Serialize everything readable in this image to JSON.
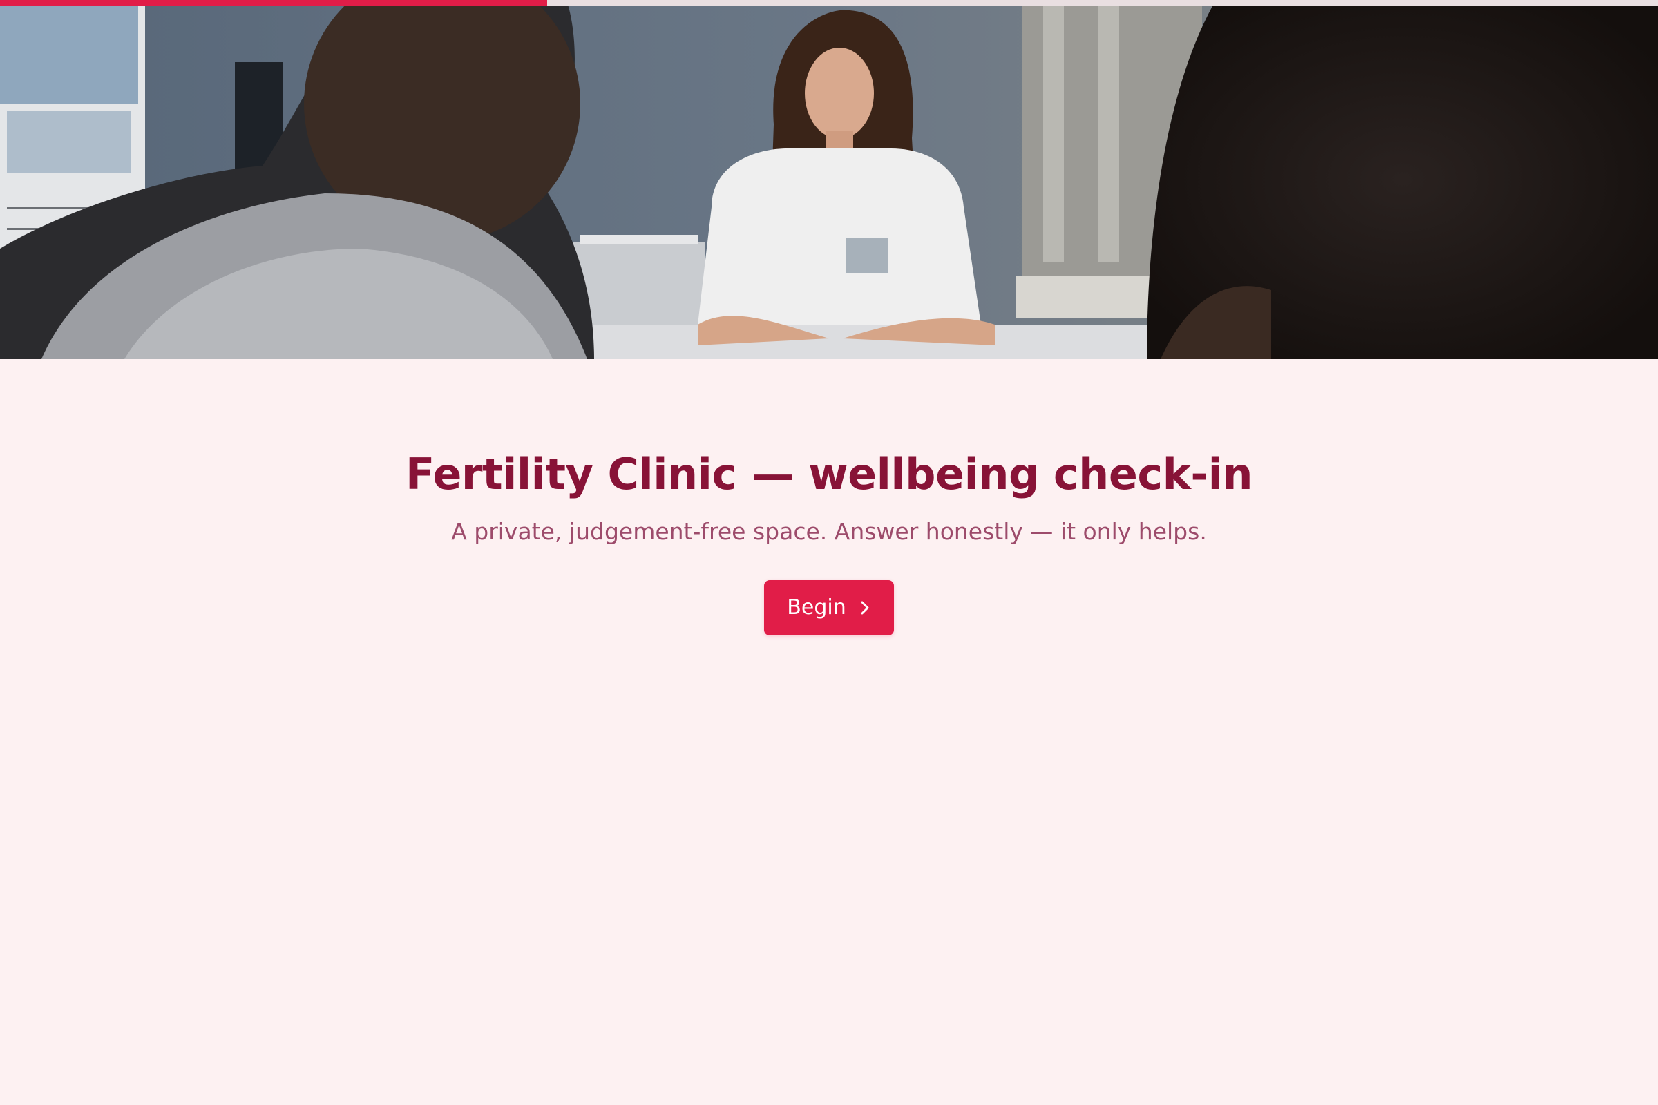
{
  "progress": {
    "fraction": 0.33
  },
  "hero": {
    "image": "clinic-consultation-photo"
  },
  "main": {
    "title": "Fertility Clinic — wellbeing check-in",
    "subtitle": "A private, judgement-free space. Answer honestly — it only helps.",
    "begin_label": "Begin",
    "begin_icon": "chevron-right-icon"
  },
  "colors": {
    "accent": "#e11d48",
    "title": "#881337",
    "subtitle": "#9d4b6b",
    "background": "#fdf1f2"
  }
}
